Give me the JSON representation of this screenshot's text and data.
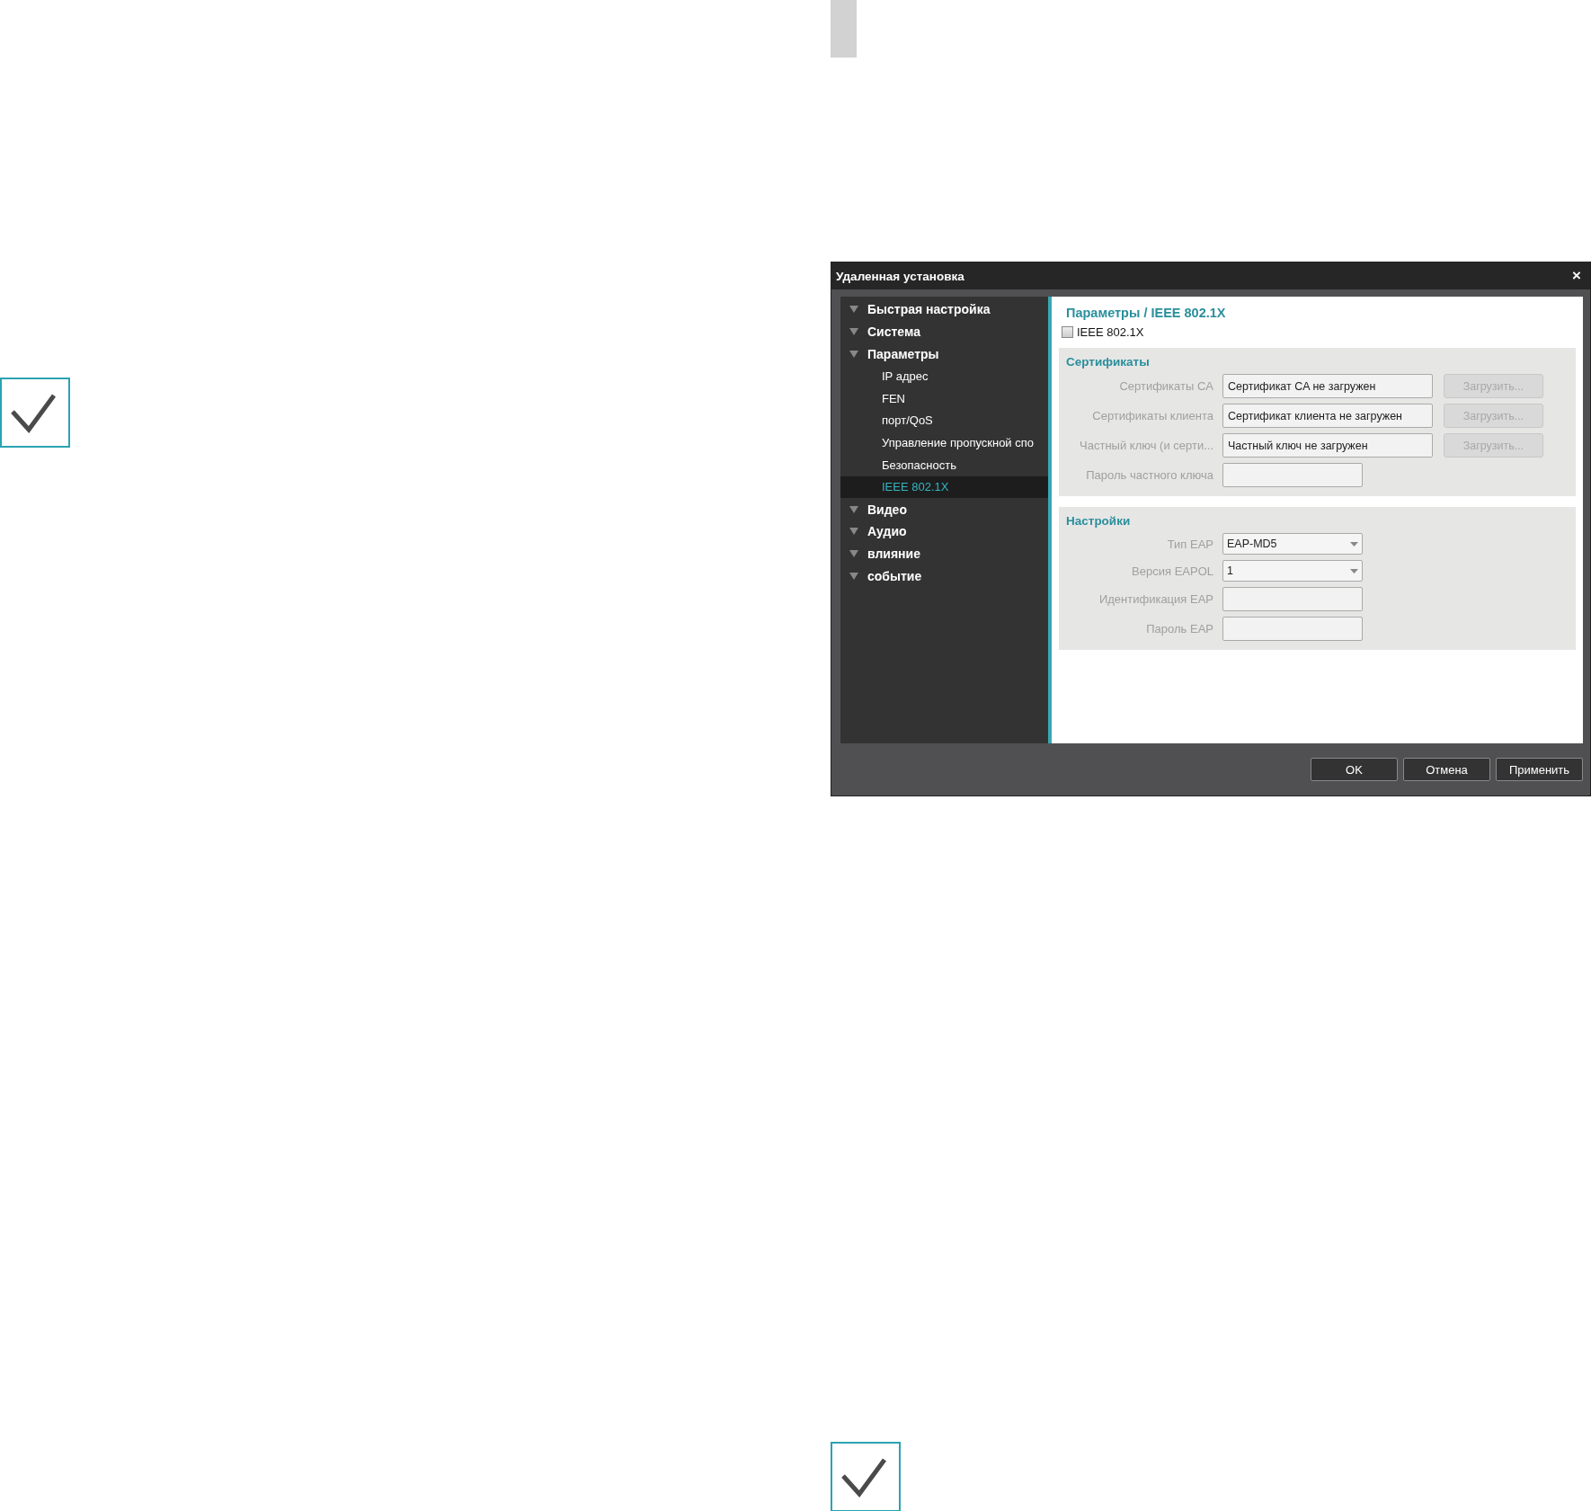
{
  "dialog": {
    "title": "Удаленная установка",
    "close": "×",
    "tree": [
      {
        "label": "Быстрая настройка",
        "selected": false
      },
      {
        "label": "Система",
        "selected": false
      },
      {
        "label": "Параметры",
        "selected": false,
        "children": [
          {
            "label": "IP адрес",
            "selected": false
          },
          {
            "label": "FEN",
            "selected": false
          },
          {
            "label": "порт/QoS",
            "selected": false
          },
          {
            "label": "Управление пропускной спо",
            "selected": false
          },
          {
            "label": "Безопасность",
            "selected": false
          },
          {
            "label": "IEEE 802.1X",
            "selected": true
          }
        ]
      },
      {
        "label": "Видео",
        "selected": false
      },
      {
        "label": "Аудио",
        "selected": false
      },
      {
        "label": "влияние",
        "selected": false
      },
      {
        "label": "событие",
        "selected": false
      }
    ],
    "breadcrumb": "Параметры / IEEE 802.1X",
    "enable": {
      "label": "IEEE 802.1X",
      "checked": false
    },
    "sections": [
      {
        "title": "Сертификаты",
        "fields": [
          {
            "kind": "file",
            "label": "Сертификаты CA",
            "value": "Сертификат CA не загружен",
            "button": "Загрузить...",
            "disabled": true
          },
          {
            "kind": "file",
            "label": "Сертификаты клиента",
            "value": "Сертификат клиента не загружен",
            "button": "Загрузить...",
            "disabled": true
          },
          {
            "kind": "file",
            "label": "Частный ключ (и серти...",
            "value": "Частный ключ не загружен",
            "button": "Загрузить...",
            "disabled": true
          },
          {
            "kind": "text",
            "label": "Пароль частного ключа",
            "disabled": true
          }
        ]
      },
      {
        "title": "Настройки",
        "fields": [
          {
            "kind": "select",
            "label": "Тип EAP",
            "value": "EAP-MD5",
            "disabled": true
          },
          {
            "kind": "select",
            "label": "Версия EAPOL",
            "value": "1",
            "disabled": true
          },
          {
            "kind": "text",
            "label": "Идентификация EAP",
            "disabled": true
          },
          {
            "kind": "text",
            "label": "Пароль EAP",
            "disabled": true
          }
        ]
      }
    ],
    "buttons": [
      "OK",
      "Отмена",
      "Применить"
    ]
  }
}
